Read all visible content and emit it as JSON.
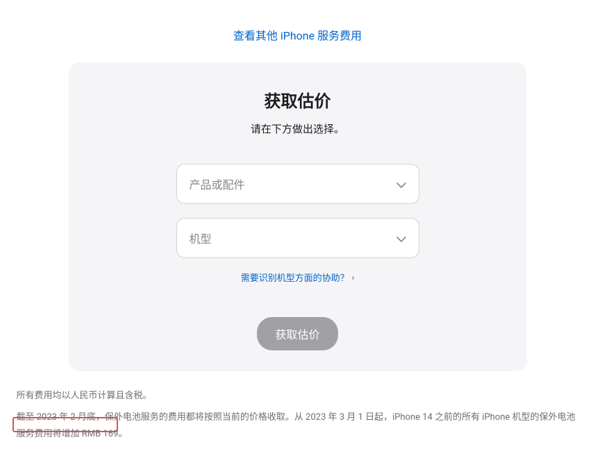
{
  "top_link": {
    "label": "查看其他 iPhone 服务费用"
  },
  "card": {
    "title": "获取估价",
    "subtitle": "请在下方做出选择。",
    "product_select": {
      "placeholder": "产品或配件"
    },
    "model_select": {
      "placeholder": "机型"
    },
    "help_link": {
      "label": "需要识别机型方面的协助？"
    },
    "submit": {
      "label": "获取估价"
    }
  },
  "disclaimer": {
    "line1": "所有费用均以人民币计算且含税。",
    "line2_prefix": "截至 2023 年 2 月底，保外电池服务的费用都将按照当前的价格收取。从 2023 年 3 月 1 日起，iPhone 14 之前的所有 iPhone 机型的保外电池服务",
    "line2_highlight": "费用将增加 RMB 169。"
  }
}
